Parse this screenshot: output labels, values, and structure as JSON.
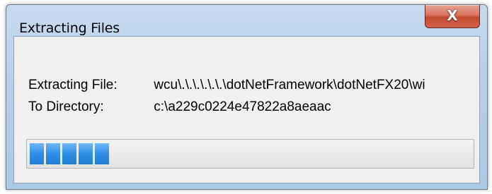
{
  "window": {
    "title": "Extracting Files",
    "close_icon": "close-icon",
    "close_glyph": "X"
  },
  "details": {
    "file_label": "Extracting File:",
    "file_value": "wcu\\.\\.\\.\\.\\.\\.\\dotNetFramework\\dotNetFX20\\wi",
    "dir_label": "To Directory:",
    "dir_value": "c:\\a229c0224e47822a8aeaac"
  },
  "progress": {
    "blocks_filled": 5,
    "fraction": 0.23,
    "fill_color": "#2f8fe6"
  }
}
